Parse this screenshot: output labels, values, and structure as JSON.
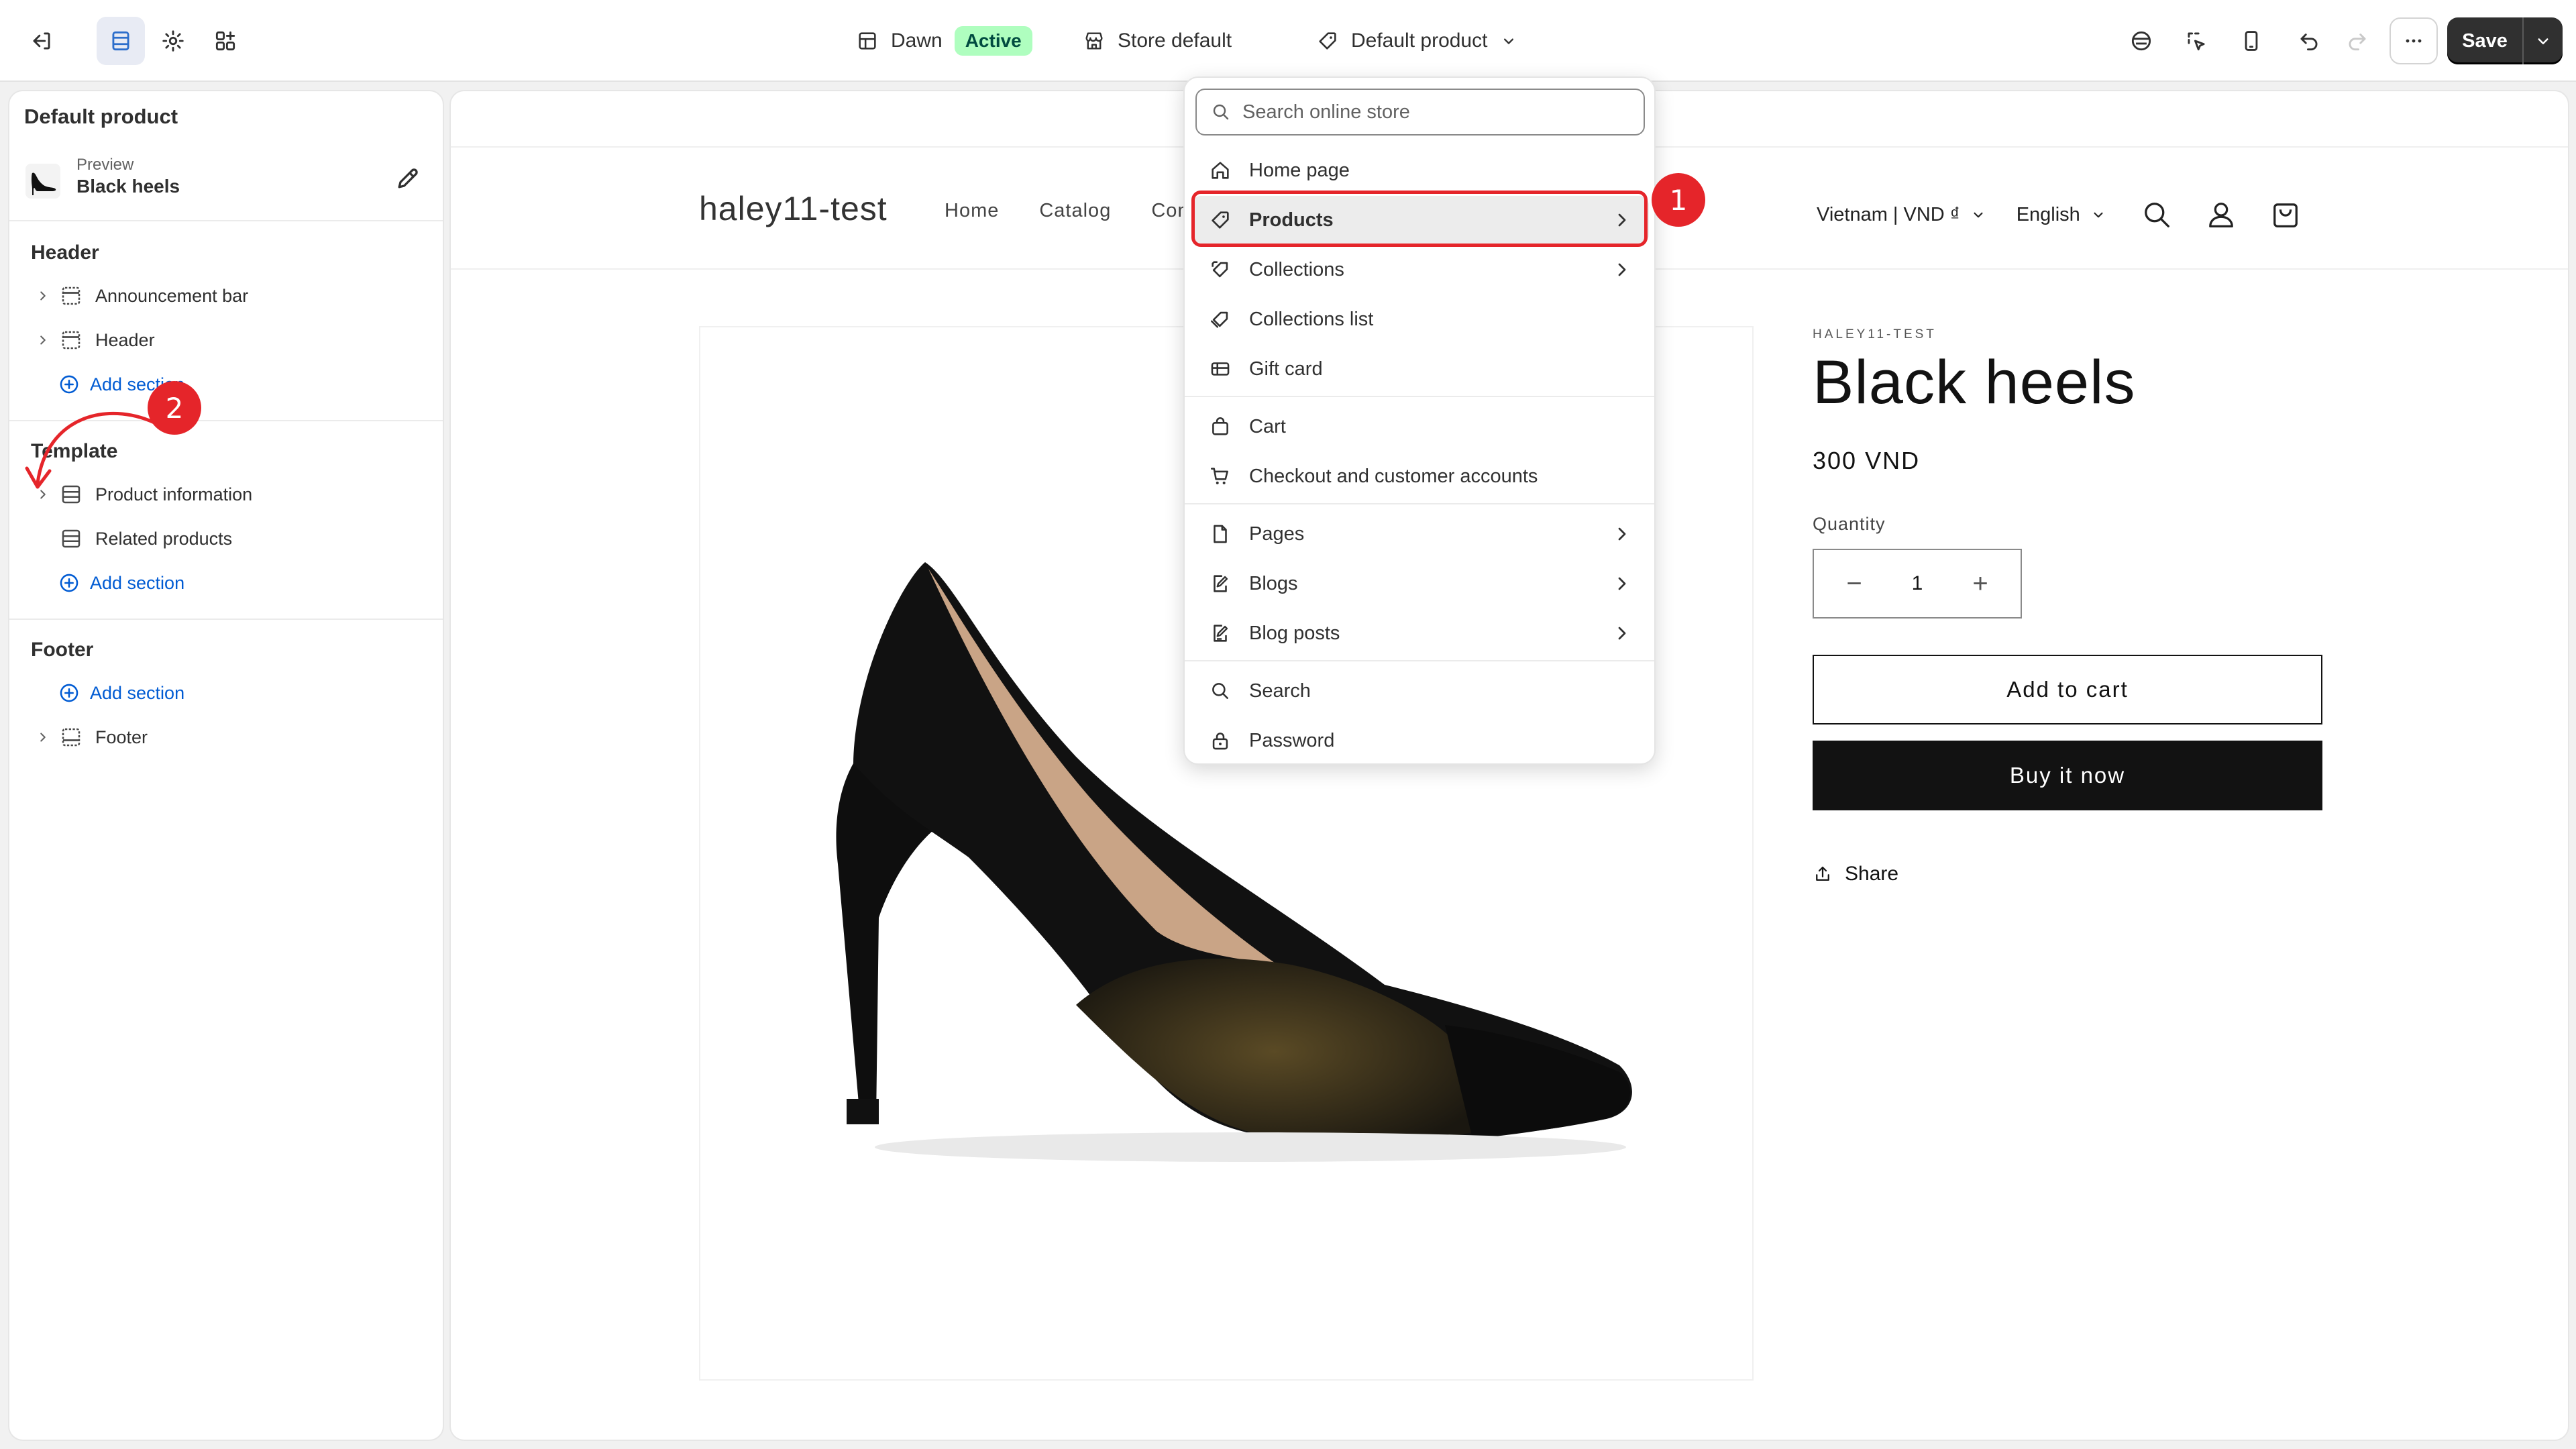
{
  "topbar": {
    "theme_name": "Dawn",
    "theme_status": "Active",
    "store_label": "Store default",
    "template_label": "Default product",
    "save_label": "Save"
  },
  "sidebar": {
    "title": "Default product",
    "preview_label": "Preview",
    "preview_name": "Black heels",
    "groups": {
      "header": {
        "title": "Header",
        "items": [
          "Announcement bar",
          "Header"
        ],
        "add_label": "Add section"
      },
      "template": {
        "title": "Template",
        "items": [
          "Product information",
          "Related products"
        ],
        "add_label": "Add section"
      },
      "footer": {
        "title": "Footer",
        "add_label": "Add section",
        "items": [
          "Footer"
        ]
      }
    }
  },
  "store": {
    "logo": "haley11-test",
    "nav": [
      "Home",
      "Catalog",
      "Cont"
    ],
    "locale": "Vietnam | VND ₫",
    "language": "English",
    "product": {
      "vendor": "HALEY11-TEST",
      "title": "Black heels",
      "price": "300 VND",
      "quantity_label": "Quantity",
      "quantity": "1",
      "add_to_cart": "Add to cart",
      "buy_now": "Buy it now",
      "share": "Share"
    }
  },
  "dropdown": {
    "search_placeholder": "Search online store",
    "items": [
      {
        "label": "Home page",
        "icon": "home-icon"
      },
      {
        "label": "Products",
        "icon": "tag-icon"
      },
      {
        "label": "Collections",
        "icon": "collection-icon"
      },
      {
        "label": "Collections list",
        "icon": "collections-list-icon"
      },
      {
        "label": "Gift card",
        "icon": "gift-card-icon"
      },
      {
        "label": "Cart",
        "icon": "cart-bag-icon"
      },
      {
        "label": "Checkout and customer accounts",
        "icon": "checkout-cart-icon"
      },
      {
        "label": "Pages",
        "icon": "page-icon"
      },
      {
        "label": "Blogs",
        "icon": "blog-icon"
      },
      {
        "label": "Blog posts",
        "icon": "blog-post-icon"
      },
      {
        "label": "Search",
        "icon": "search-icon"
      },
      {
        "label": "Password",
        "icon": "lock-icon"
      }
    ]
  },
  "annotations": {
    "step1": "1",
    "step2": "2"
  },
  "colors": {
    "accent_link": "#005bd3",
    "annotation_red": "#e5252a",
    "active_badge_bg": "#affebf",
    "primary_button": "#303030"
  }
}
